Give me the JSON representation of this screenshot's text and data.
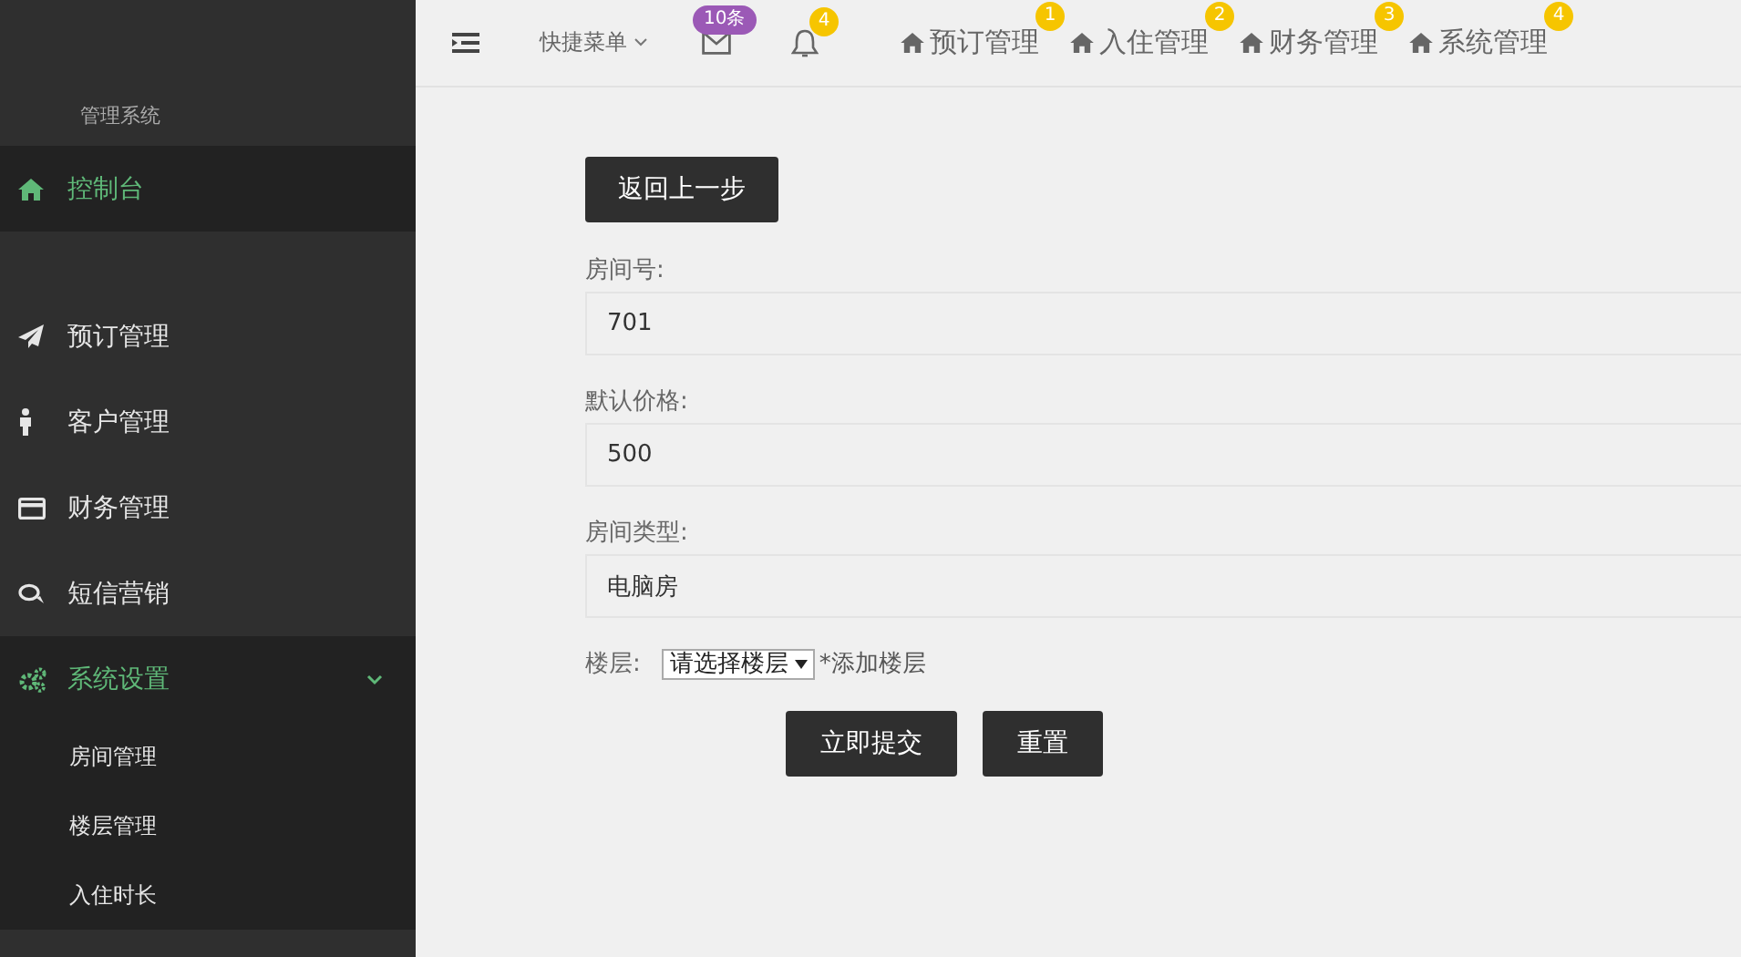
{
  "sidebar": {
    "subtitle": "管理系统",
    "items": [
      {
        "label": "控制台",
        "selected": true
      },
      {
        "label": "预订管理",
        "selected": false
      },
      {
        "label": "客户管理",
        "selected": false
      },
      {
        "label": "财务管理",
        "selected": false
      },
      {
        "label": "短信营销",
        "selected": false
      },
      {
        "label": "系统设置",
        "selected": true,
        "expanded": true,
        "children": [
          {
            "label": "房间管理"
          },
          {
            "label": "楼层管理"
          },
          {
            "label": "入住时长"
          }
        ]
      }
    ]
  },
  "topbar": {
    "quick_menu": "快捷菜单",
    "mail_badge": "10条",
    "bell_badge": "4",
    "nav": [
      {
        "label": "预订管理",
        "badge": "1"
      },
      {
        "label": "入住管理",
        "badge": "2"
      },
      {
        "label": "财务管理",
        "badge": "3"
      },
      {
        "label": "系统管理",
        "badge": "4"
      }
    ]
  },
  "form": {
    "back_button": "返回上一步",
    "fields": [
      {
        "label": "房间号:",
        "value": "701"
      },
      {
        "label": "默认价格:",
        "value": "500"
      },
      {
        "label": "房间类型:",
        "value": "电脑房"
      }
    ],
    "floor": {
      "label": "楼层:",
      "select": "请选择楼层",
      "add_link": "*添加楼层"
    },
    "buttons": [
      "立即提交",
      "重置"
    ]
  }
}
